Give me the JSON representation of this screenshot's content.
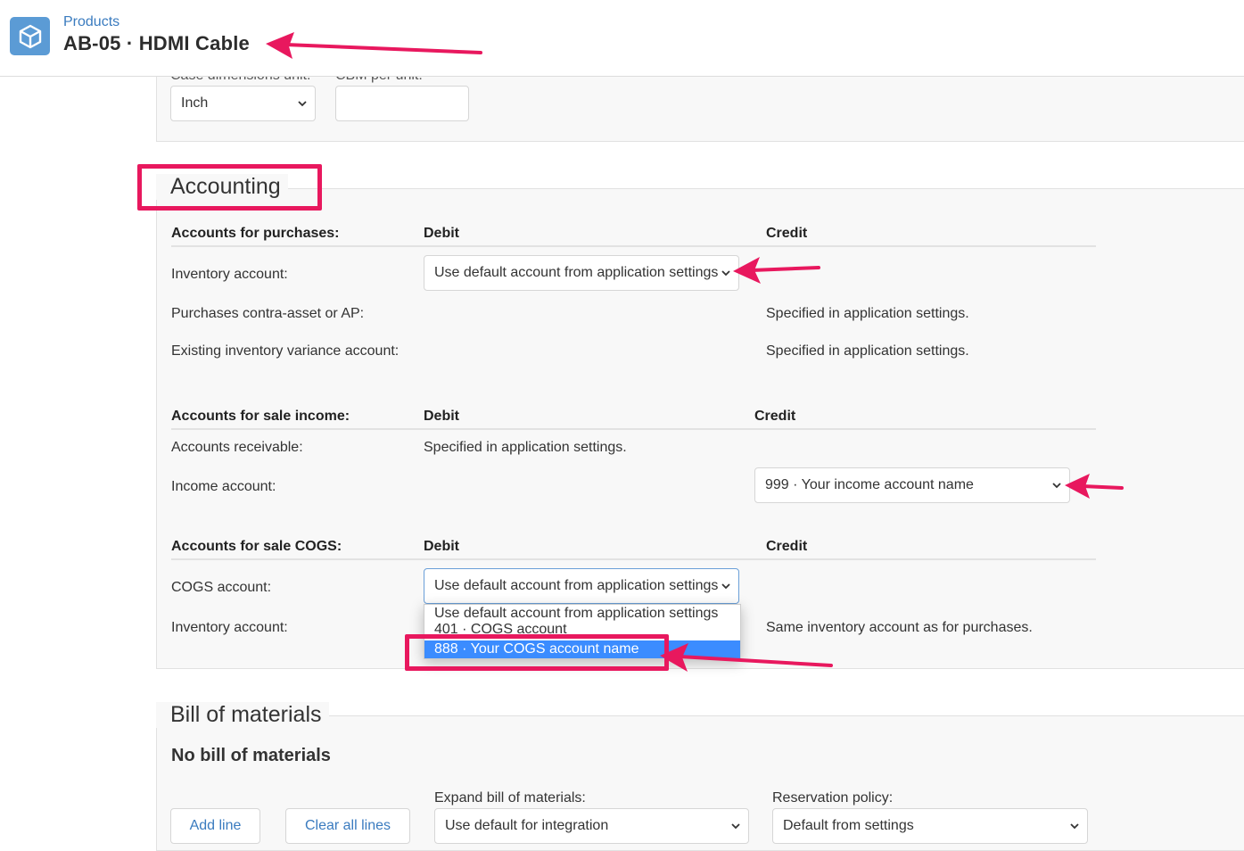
{
  "header": {
    "breadcrumb": "Products",
    "title": "AB-05 · HDMI Cable",
    "icon": "box-icon"
  },
  "dimensions": {
    "case_unit_label": "Case dimensions unit:",
    "case_unit_value": "Inch",
    "cbm_label": "CBM per unit:",
    "cbm_value": ""
  },
  "accounting": {
    "legend": "Accounting",
    "purchases": {
      "header": "Accounts for purchases:",
      "debit": "Debit",
      "credit": "Credit",
      "inventory_label": "Inventory account:",
      "inventory_value": "Use default account from application settings",
      "contra_label": "Purchases contra-asset or AP:",
      "contra_credit": "Specified in application settings.",
      "variance_label": "Existing inventory variance account:",
      "variance_credit": "Specified in application settings."
    },
    "sale_income": {
      "header": "Accounts for sale income:",
      "debit": "Debit",
      "credit": "Credit",
      "receivable_label": "Accounts receivable:",
      "receivable_debit": "Specified in application settings.",
      "income_label": "Income account:",
      "income_value": "999 · Your income account name"
    },
    "sale_cogs": {
      "header": "Accounts for sale COGS:",
      "debit": "Debit",
      "credit": "Credit",
      "cogs_label": "COGS account:",
      "cogs_value": "Use default account from application settings",
      "inventory_label": "Inventory account:",
      "inventory_credit": "Same inventory account as for purchases.",
      "dropdown_options": [
        "Use default account from application settings",
        "401 · COGS account",
        "888 · Your COGS account name"
      ],
      "selected_option_index": 2
    }
  },
  "bom": {
    "legend": "Bill of materials",
    "empty_text": "No bill of materials",
    "add_line": "Add line",
    "clear_lines": "Clear all lines",
    "expand_label": "Expand bill of materials:",
    "expand_value": "Use default for integration",
    "reservation_label": "Reservation policy:",
    "reservation_value": "Default from settings"
  },
  "annotation_color": "#e8185e",
  "accent_color": "#3a7bbf"
}
